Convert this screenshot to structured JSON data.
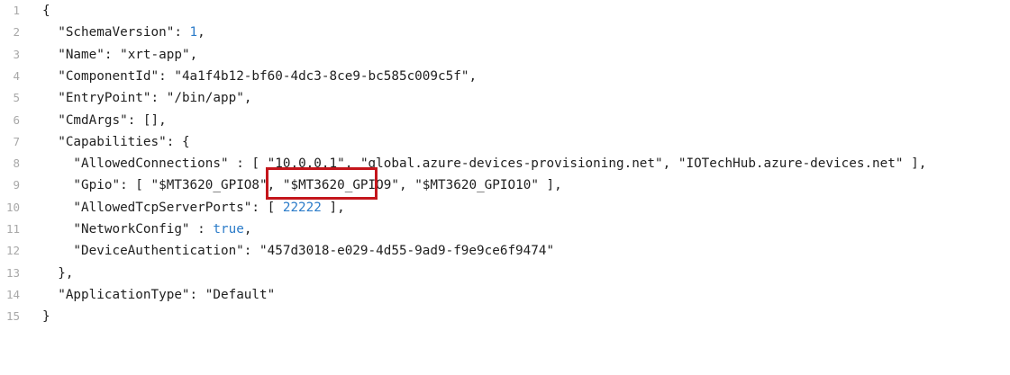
{
  "editor": {
    "lines": [
      {
        "num": "1",
        "tokens": [
          {
            "t": "{",
            "c": "punc"
          }
        ]
      },
      {
        "num": "2",
        "tokens": [
          {
            "t": "  \"SchemaVersion\"",
            "c": "key"
          },
          {
            "t": ": ",
            "c": "punc"
          },
          {
            "t": "1",
            "c": "num"
          },
          {
            "t": ",",
            "c": "punc"
          }
        ]
      },
      {
        "num": "3",
        "tokens": [
          {
            "t": "  \"Name\"",
            "c": "key"
          },
          {
            "t": ": ",
            "c": "punc"
          },
          {
            "t": "\"xrt-app\"",
            "c": "str"
          },
          {
            "t": ",",
            "c": "punc"
          }
        ]
      },
      {
        "num": "4",
        "tokens": [
          {
            "t": "  \"ComponentId\"",
            "c": "key"
          },
          {
            "t": ": ",
            "c": "punc"
          },
          {
            "t": "\"4a1f4b12-bf60-4dc3-8ce9-bc585c009c5f\"",
            "c": "str"
          },
          {
            "t": ",",
            "c": "punc"
          }
        ]
      },
      {
        "num": "5",
        "tokens": [
          {
            "t": "  \"EntryPoint\"",
            "c": "key"
          },
          {
            "t": ": ",
            "c": "punc"
          },
          {
            "t": "\"/bin/app\"",
            "c": "str"
          },
          {
            "t": ",",
            "c": "punc"
          }
        ]
      },
      {
        "num": "6",
        "tokens": [
          {
            "t": "  \"CmdArgs\"",
            "c": "key"
          },
          {
            "t": ": [],",
            "c": "punc"
          }
        ]
      },
      {
        "num": "7",
        "tokens": [
          {
            "t": "  \"Capabilities\"",
            "c": "key"
          },
          {
            "t": ": {",
            "c": "punc"
          }
        ]
      },
      {
        "num": "8",
        "tokens": [
          {
            "t": "    \"AllowedConnections\"",
            "c": "key"
          },
          {
            "t": " : [ ",
            "c": "punc"
          },
          {
            "t": "\"10.0.0.1\"",
            "c": "str"
          },
          {
            "t": ", ",
            "c": "punc"
          },
          {
            "t": "\"global.azure-devices-provisioning.net\"",
            "c": "str"
          },
          {
            "t": ", ",
            "c": "punc"
          },
          {
            "t": "\"IOTechHub.azure-devices.net\"",
            "c": "str"
          },
          {
            "t": " ],",
            "c": "punc"
          }
        ]
      },
      {
        "num": "9",
        "tokens": [
          {
            "t": "    \"Gpio\"",
            "c": "key"
          },
          {
            "t": ": [ ",
            "c": "punc"
          },
          {
            "t": "\"$MT3620_GPIO8\"",
            "c": "str"
          },
          {
            "t": ", ",
            "c": "punc"
          },
          {
            "t": "\"$MT3620_GPIO9\"",
            "c": "str"
          },
          {
            "t": ", ",
            "c": "punc"
          },
          {
            "t": "\"$MT3620_GPIO10\"",
            "c": "str"
          },
          {
            "t": " ],",
            "c": "punc"
          }
        ]
      },
      {
        "num": "10",
        "tokens": [
          {
            "t": "    \"AllowedTcpServerPorts\"",
            "c": "key"
          },
          {
            "t": ": [ ",
            "c": "punc"
          },
          {
            "t": "22222",
            "c": "num"
          },
          {
            "t": " ],",
            "c": "punc"
          }
        ]
      },
      {
        "num": "11",
        "tokens": [
          {
            "t": "    \"NetworkConfig\"",
            "c": "key"
          },
          {
            "t": " : ",
            "c": "punc"
          },
          {
            "t": "true",
            "c": "bool"
          },
          {
            "t": ",",
            "c": "punc"
          }
        ]
      },
      {
        "num": "12",
        "tokens": [
          {
            "t": "    \"DeviceAuthentication\"",
            "c": "key"
          },
          {
            "t": ": ",
            "c": "punc"
          },
          {
            "t": "\"457d3018-e029-4d55-9ad9-f9e9ce6f9474\"",
            "c": "str"
          }
        ]
      },
      {
        "num": "13",
        "tokens": [
          {
            "t": "  },",
            "c": "punc"
          }
        ]
      },
      {
        "num": "14",
        "tokens": [
          {
            "t": "  \"ApplicationType\"",
            "c": "key"
          },
          {
            "t": ": ",
            "c": "punc"
          },
          {
            "t": "\"Default\"",
            "c": "str"
          }
        ]
      },
      {
        "num": "15",
        "tokens": [
          {
            "t": "}",
            "c": "punc"
          }
        ]
      }
    ],
    "highlight": {
      "line": "8",
      "text": "[ \"10.0.0.1\","
    }
  },
  "colors": {
    "background": "#ffffff",
    "text": "#1f1f1f",
    "line_number": "#a8a8a8",
    "number_literal": "#2c7cc9",
    "highlight_border": "#c4161c"
  }
}
